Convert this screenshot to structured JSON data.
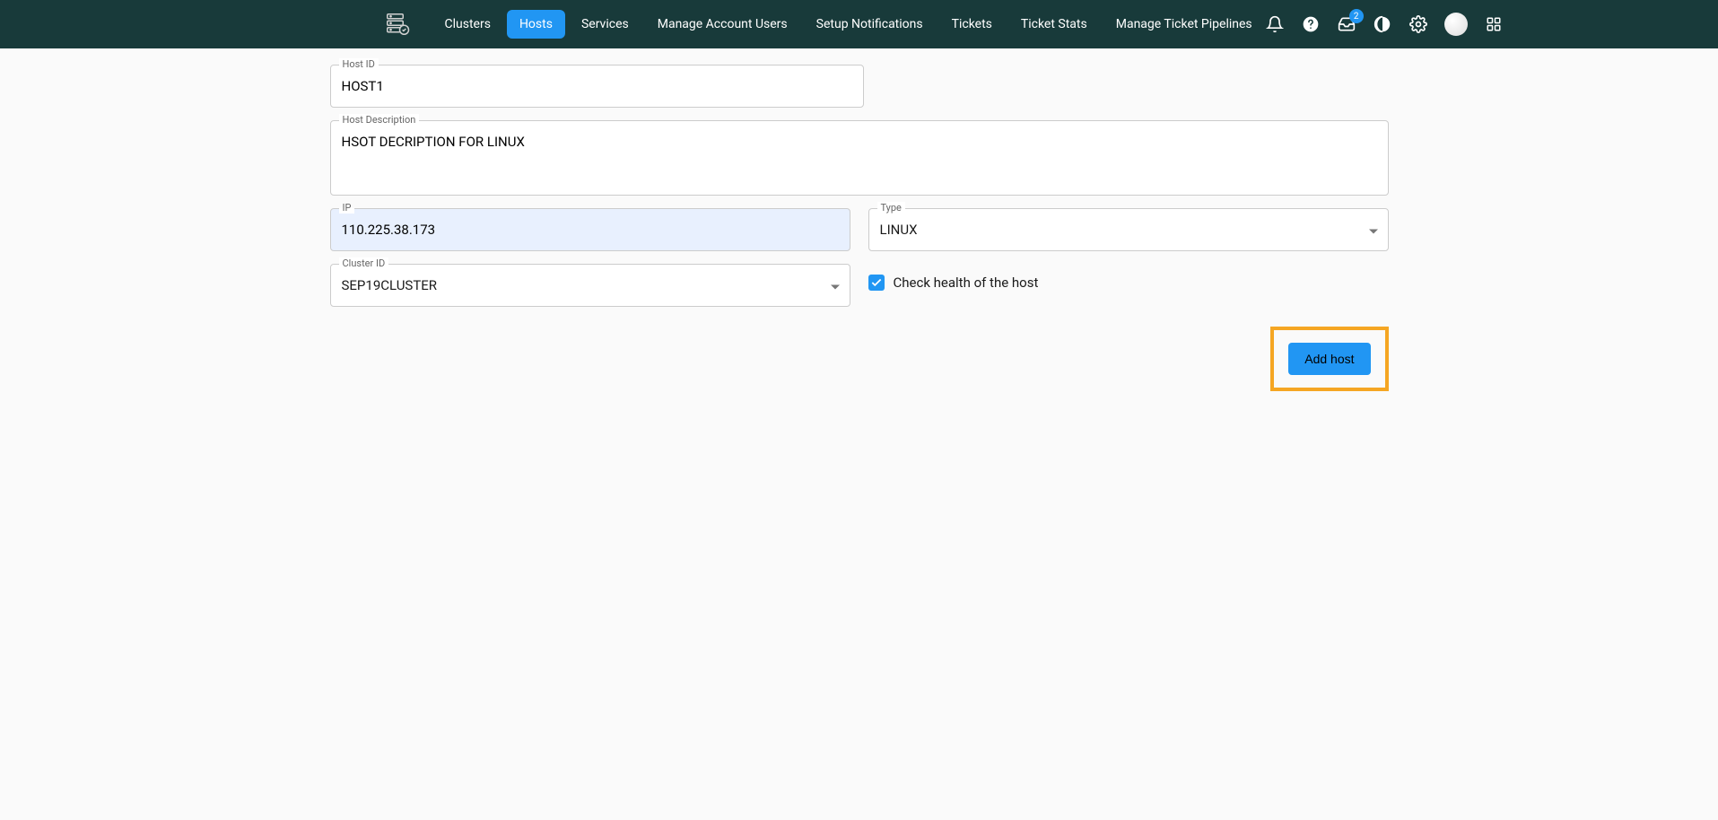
{
  "nav": {
    "items": [
      {
        "label": "Clusters",
        "active": false
      },
      {
        "label": "Hosts",
        "active": true
      },
      {
        "label": "Services",
        "active": false
      },
      {
        "label": "Manage Account Users",
        "active": false
      },
      {
        "label": "Setup Notifications",
        "active": false
      },
      {
        "label": "Tickets",
        "active": false
      },
      {
        "label": "Ticket Stats",
        "active": false
      },
      {
        "label": "Manage Ticket Pipelines",
        "active": false
      }
    ],
    "badge_count": "2"
  },
  "form": {
    "host_id": {
      "label": "Host ID",
      "value": "HOST1"
    },
    "host_description": {
      "label": "Host Description",
      "value": "HSOT DECRIPTION FOR LINUX"
    },
    "ip": {
      "label": "IP",
      "value": "110.225.38.173"
    },
    "type": {
      "label": "Type",
      "value": "LINUX"
    },
    "cluster_id": {
      "label": "Cluster ID",
      "value": "SEP19CLUSTER"
    },
    "check_health": {
      "label": "Check health of the host",
      "checked": true
    },
    "submit_label": "Add host"
  }
}
